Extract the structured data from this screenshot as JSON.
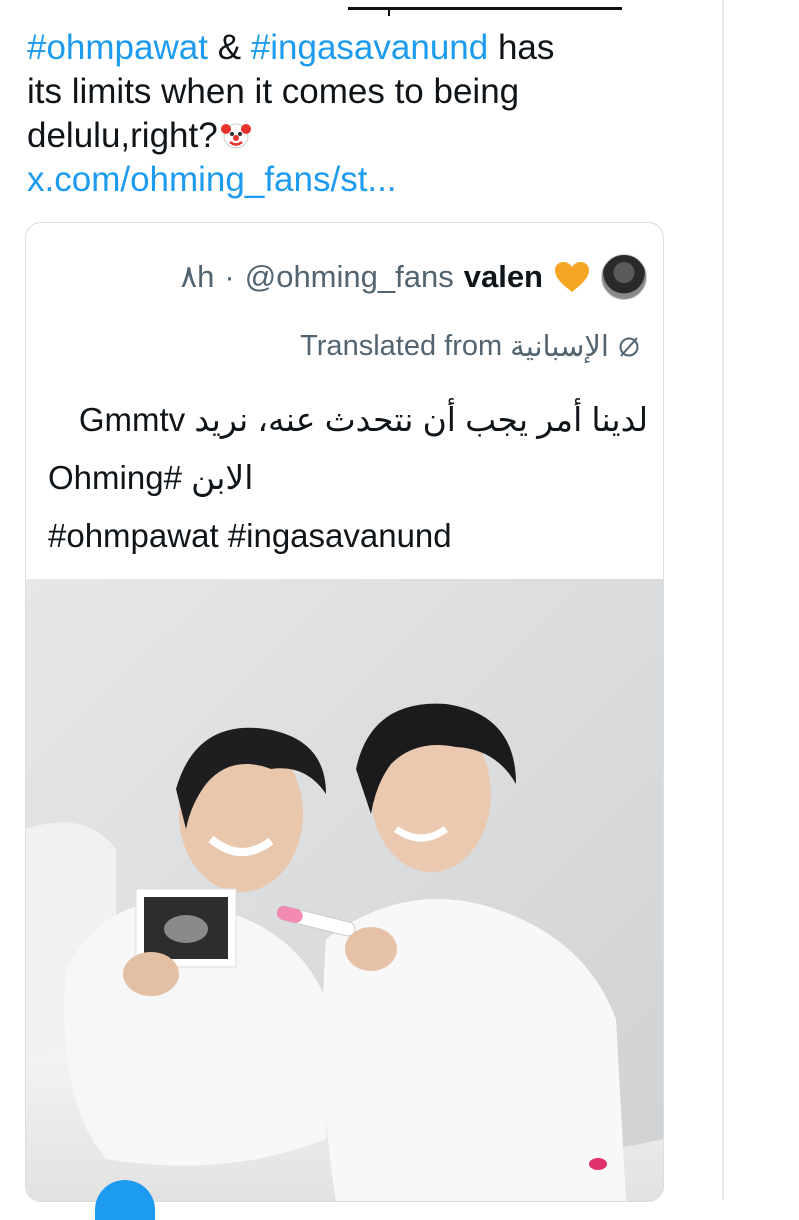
{
  "tweet": {
    "tag1": "#ohmpawat",
    "amp": "&",
    "tag2": "#ingasavanund",
    "text_part1": "has",
    "text_part2": "its limits when it comes to being",
    "text_part3": "delulu,right?",
    "emoji": "clown-face",
    "link": "x.com/ohming_fans/st..."
  },
  "quoted": {
    "time": "٨h",
    "separator": "·",
    "handle": "@ohming_fans",
    "name": "valen",
    "name_emoji": "orange-heart",
    "translated_label": "Translated from",
    "translated_lang": "الإسبانية",
    "body_line1": "لدينا أمر يجب أن نتحدث عنه، نريد Gmmtv",
    "body_line2": "الابن #Ohming",
    "body_line3": "#ohmpawat #ingasavanund"
  },
  "colors": {
    "link": "#1d9bf0",
    "text": "#0f1419",
    "muted": "#536471",
    "heart": "#f5a623"
  }
}
